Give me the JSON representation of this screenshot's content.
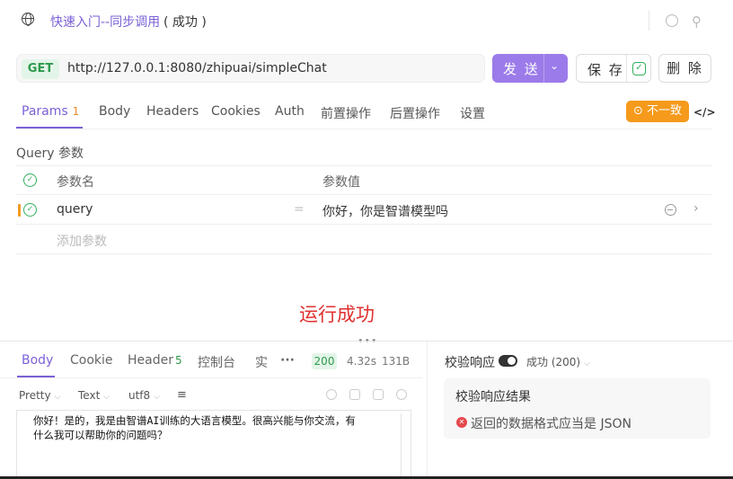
{
  "title": {
    "text": "快速入门--同步调用",
    "status": "( 成功 )"
  },
  "request": {
    "method": "GET",
    "url": "http://127.0.0.1:8080/zhipuai/simpleChat",
    "send_label": "发 送",
    "save_label": "保 存",
    "delete_label": "删 除"
  },
  "tabs": [
    {
      "label": "Params",
      "count": "1"
    },
    {
      "label": "Body"
    },
    {
      "label": "Headers"
    },
    {
      "label": "Cookies"
    },
    {
      "label": "Auth"
    },
    {
      "label": "前置操作"
    },
    {
      "label": "后置操作"
    },
    {
      "label": "设置"
    }
  ],
  "inconsistent_badge": "⊙ 不一致",
  "params": {
    "section_title": "Query 参数",
    "col_name": "参数名",
    "col_value": "参数值",
    "rows": [
      {
        "name": "query",
        "value": "你好，你是智谱模型吗"
      }
    ],
    "add_placeholder": "添加参数"
  },
  "success_message": "运行成功",
  "response": {
    "tabs": [
      {
        "label": "Body"
      },
      {
        "label": "Cookie"
      },
      {
        "label": "Header",
        "count": "5"
      },
      {
        "label": "控制台"
      },
      {
        "label": "实"
      }
    ],
    "status_code": "200",
    "time": "4.32s",
    "size": "131B",
    "format": "Pretty",
    "type": "Text",
    "encoding": "utf8",
    "body_lines": [
      "你好！是的，我是由智谱AI训练的大语言模型。很高兴能与你交流，有",
      "什么我可以帮助你的问题吗？"
    ]
  },
  "validation": {
    "title": "校验响应",
    "status": "成功 (200)",
    "result_title": "校验响应结果",
    "error": "返回的数据格式应当是 JSON"
  }
}
